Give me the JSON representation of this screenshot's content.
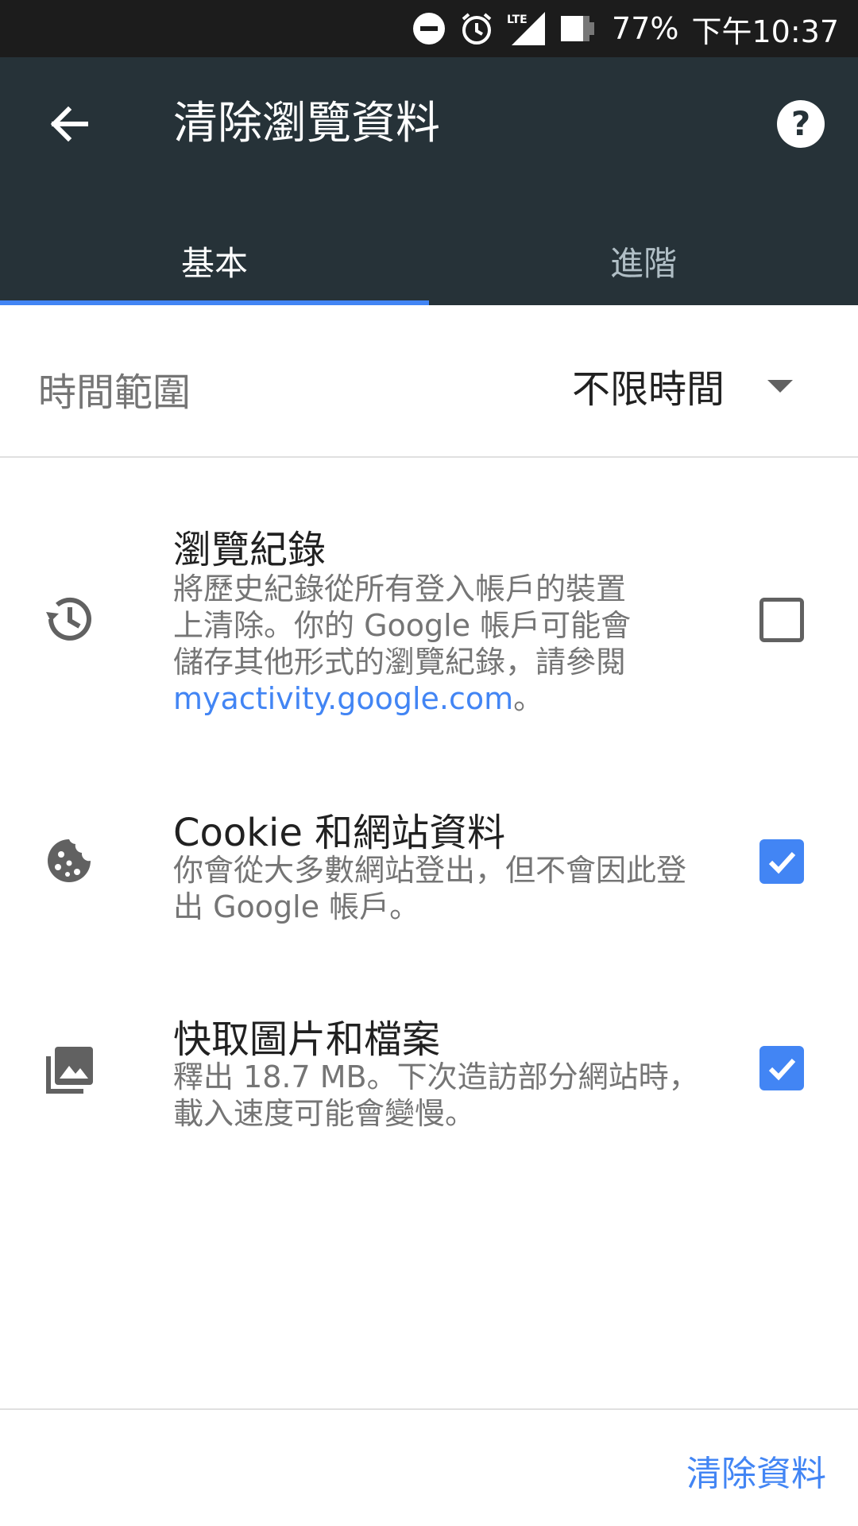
{
  "status_bar": {
    "battery_percent": "77%",
    "time": "下午10:37",
    "icons": [
      "do-not-disturb-icon",
      "alarm-icon",
      "lte-signal-icon",
      "battery-icon"
    ],
    "network": "LTE"
  },
  "app_bar": {
    "title": "清除瀏覽資料",
    "back_icon": "arrow-back-icon",
    "help_icon": "help-icon"
  },
  "tabs": [
    {
      "label": "基本",
      "active": true
    },
    {
      "label": "進階",
      "active": false
    }
  ],
  "time_range": {
    "label": "時間範圍",
    "value": "不限時間"
  },
  "options": [
    {
      "icon": "history-icon",
      "title": "瀏覽紀錄",
      "description_lines": [
        "將歷史紀錄從所有登入帳戶的裝置",
        "上清除。你的 Google 帳戶可能會",
        "儲存其他形式的瀏覽紀錄，請參閱"
      ],
      "link_text": "myactivity.google.com",
      "link_suffix": "。",
      "checked": false
    },
    {
      "icon": "cookie-icon",
      "title": "Cookie 和網站資料",
      "description_lines": [
        "你會從大多數網站登出，但不會因此登",
        "出 Google 帳戶。"
      ],
      "checked": true
    },
    {
      "icon": "image-icon",
      "title": "快取圖片和檔案",
      "description_lines": [
        "釋出 18.7 MB。下次造訪部分網站時，",
        "載入速度可能會變慢。"
      ],
      "checked": true
    }
  ],
  "footer": {
    "clear_button": "清除資料"
  },
  "colors": {
    "app_bar": "#263238",
    "status_bar": "#1c1c1c",
    "accent": "#4285f4"
  }
}
